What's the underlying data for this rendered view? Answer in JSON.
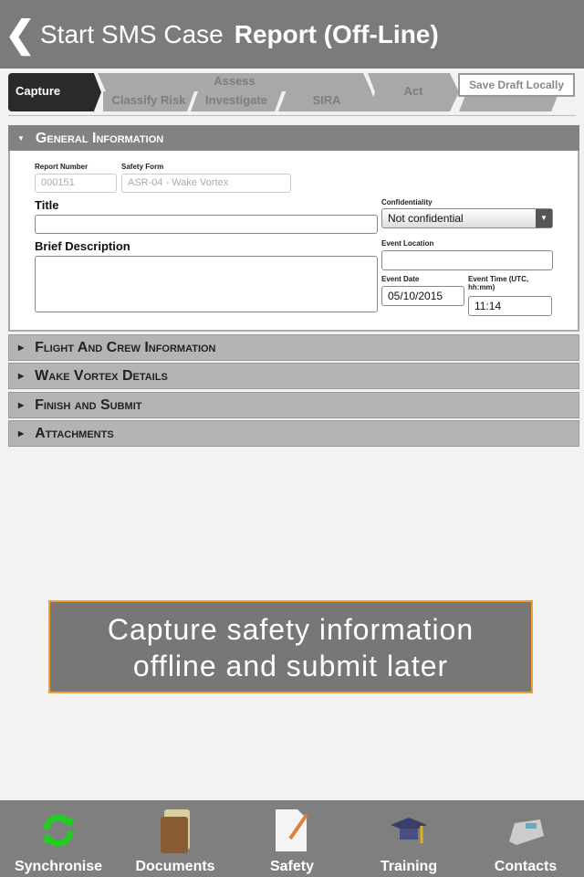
{
  "header": {
    "back_icon": "chevron-left-icon",
    "title_prefix": "Start SMS Case",
    "title": "Report (Off-Line)"
  },
  "steps": {
    "capture": "Capture",
    "assess": "Assess",
    "classify": "Classify Risk",
    "investigate": "Investigate",
    "sira": "SIRA",
    "act": "Act",
    "save": "Save Draft Locally"
  },
  "sections": {
    "general": "General Information",
    "flight": "Flight And Crew Information",
    "wake": "Wake Vortex Details",
    "finish": "Finish and Submit",
    "attach": "Attachments"
  },
  "form": {
    "report_number_label": "Report Number",
    "report_number": "000151",
    "safety_form_label": "Safety Form",
    "safety_form": "ASR-04 - Wake Vortex",
    "title_label": "Title",
    "title_value": "",
    "confidentiality_label": "Confidentiality",
    "confidentiality": "Not confidential",
    "desc_label": "Brief Description",
    "location_label": "Event Location",
    "date_label": "Event Date",
    "date": "05/10/2015",
    "time_label": "Event Time (UTC, hh:mm)",
    "time": "11:14"
  },
  "banner": {
    "line1": "Capture safety information",
    "line2": "offline and submit later"
  },
  "tabbar": [
    {
      "label": "Synchronise",
      "icon": "sync-icon"
    },
    {
      "label": "Documents",
      "icon": "books-icon"
    },
    {
      "label": "Safety",
      "icon": "document-pencil-icon"
    },
    {
      "label": "Training",
      "icon": "graduation-cap-icon"
    },
    {
      "label": "Contacts",
      "icon": "telephone-icon"
    }
  ],
  "colors": {
    "header": "#7b7b7b",
    "banner_border": "#f0a030",
    "active_step": "#2a2a2a"
  }
}
